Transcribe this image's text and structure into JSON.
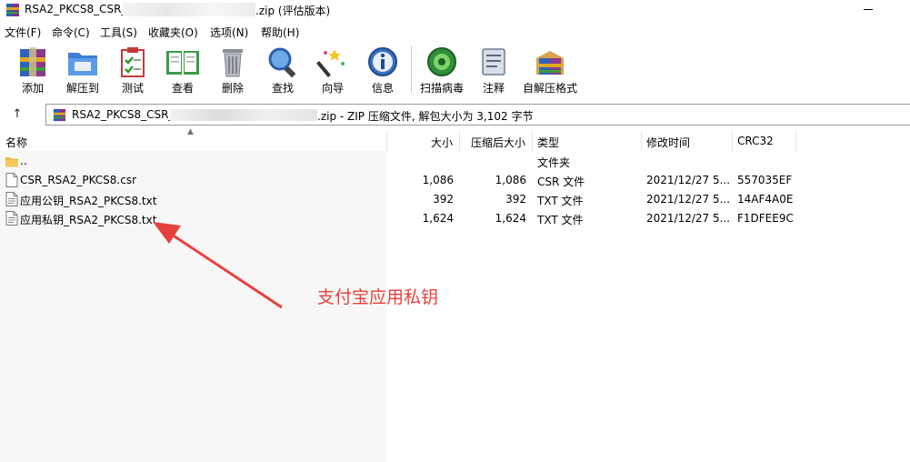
{
  "window": {
    "title": "RSA2_PKCS8_CSR_",
    "title_suffix": ".zip (评估版本)"
  },
  "menu": [
    "文件(F)",
    "命令(C)",
    "工具(S)",
    "收藏夹(O)",
    "选项(N)",
    "帮助(H)"
  ],
  "toolbar": {
    "add": "添加",
    "extract": "解压到",
    "test": "测试",
    "view": "查看",
    "delete": "删除",
    "find": "查找",
    "wizard": "向导",
    "info": "信息",
    "scan": "扫描病毒",
    "comment": "注释",
    "sfx": "自解压格式"
  },
  "address": {
    "prefix": "RSA2_PKCS8_CSR_",
    "suffix": ".zip - ZIP 压缩文件, 解包大小为 3,102 字节"
  },
  "columns": {
    "name": "名称",
    "size": "大小",
    "packed": "压缩后大小",
    "type": "类型",
    "modified": "修改时间",
    "crc": "CRC32"
  },
  "files": [
    {
      "name": "..",
      "size": "",
      "packed": "",
      "type": "文件夹",
      "modified": "",
      "crc": "",
      "icon": "folder-icon"
    },
    {
      "name": "CSR_RSA2_PKCS8.csr",
      "size": "1,086",
      "packed": "1,086",
      "type": "CSR 文件",
      "modified": "2021/12/27 5...",
      "crc": "557035EF",
      "icon": "file-icon"
    },
    {
      "name": "应用公钥_RSA2_PKCS8.txt",
      "size": "392",
      "packed": "392",
      "type": "TXT 文件",
      "modified": "2021/12/27 5...",
      "crc": "14AF4A0E",
      "icon": "text-file-icon"
    },
    {
      "name": "应用私钥_RSA2_PKCS8.txt",
      "size": "1,624",
      "packed": "1,624",
      "type": "TXT 文件",
      "modified": "2021/12/27 5...",
      "crc": "F1DFEE9C",
      "icon": "text-file-icon"
    }
  ],
  "annotation": {
    "text": "支付宝应用私钥",
    "color": "#e8413c"
  }
}
